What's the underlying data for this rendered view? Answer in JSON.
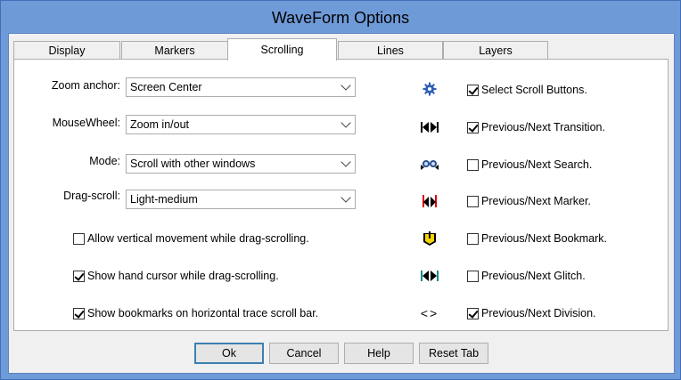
{
  "window": {
    "title": "WaveForm Options"
  },
  "tabs": [
    "Display",
    "Markers",
    "Scrolling",
    "Lines",
    "Layers"
  ],
  "active_tab": "Scrolling",
  "fields": [
    {
      "label": "Zoom anchor:",
      "value": "Screen Center"
    },
    {
      "label": "MouseWheel:",
      "value": "Zoom in/out"
    },
    {
      "label": "Mode:",
      "value": "Scroll with other windows"
    },
    {
      "label": "Drag-scroll:",
      "value": "Light-medium"
    }
  ],
  "left_checks": [
    {
      "label": "Allow vertical movement while drag-scrolling.",
      "checked": false
    },
    {
      "label": "Show hand cursor while drag-scrolling.",
      "checked": true
    },
    {
      "label": "Show bookmarks on horizontal trace scroll bar.",
      "checked": true
    }
  ],
  "right_checks": [
    {
      "label": "Select Scroll Buttons.",
      "checked": true,
      "icon": "gear-icon"
    },
    {
      "label": "Previous/Next Transition.",
      "checked": true,
      "icon": "transition-arrows-icon"
    },
    {
      "label": "Previous/Next Search.",
      "checked": false,
      "icon": "binoculars-icon"
    },
    {
      "label": "Previous/Next Marker.",
      "checked": false,
      "icon": "marker-arrows-icon"
    },
    {
      "label": "Previous/Next Bookmark.",
      "checked": false,
      "icon": "bookmark-icon"
    },
    {
      "label": "Previous/Next Glitch.",
      "checked": false,
      "icon": "glitch-arrows-icon"
    },
    {
      "label": "Previous/Next Division.",
      "checked": true,
      "icon": "division-arrows-icon"
    }
  ],
  "division_glyph": "<>",
  "buttons": {
    "ok": "Ok",
    "cancel": "Cancel",
    "help": "Help",
    "reset": "Reset Tab"
  }
}
